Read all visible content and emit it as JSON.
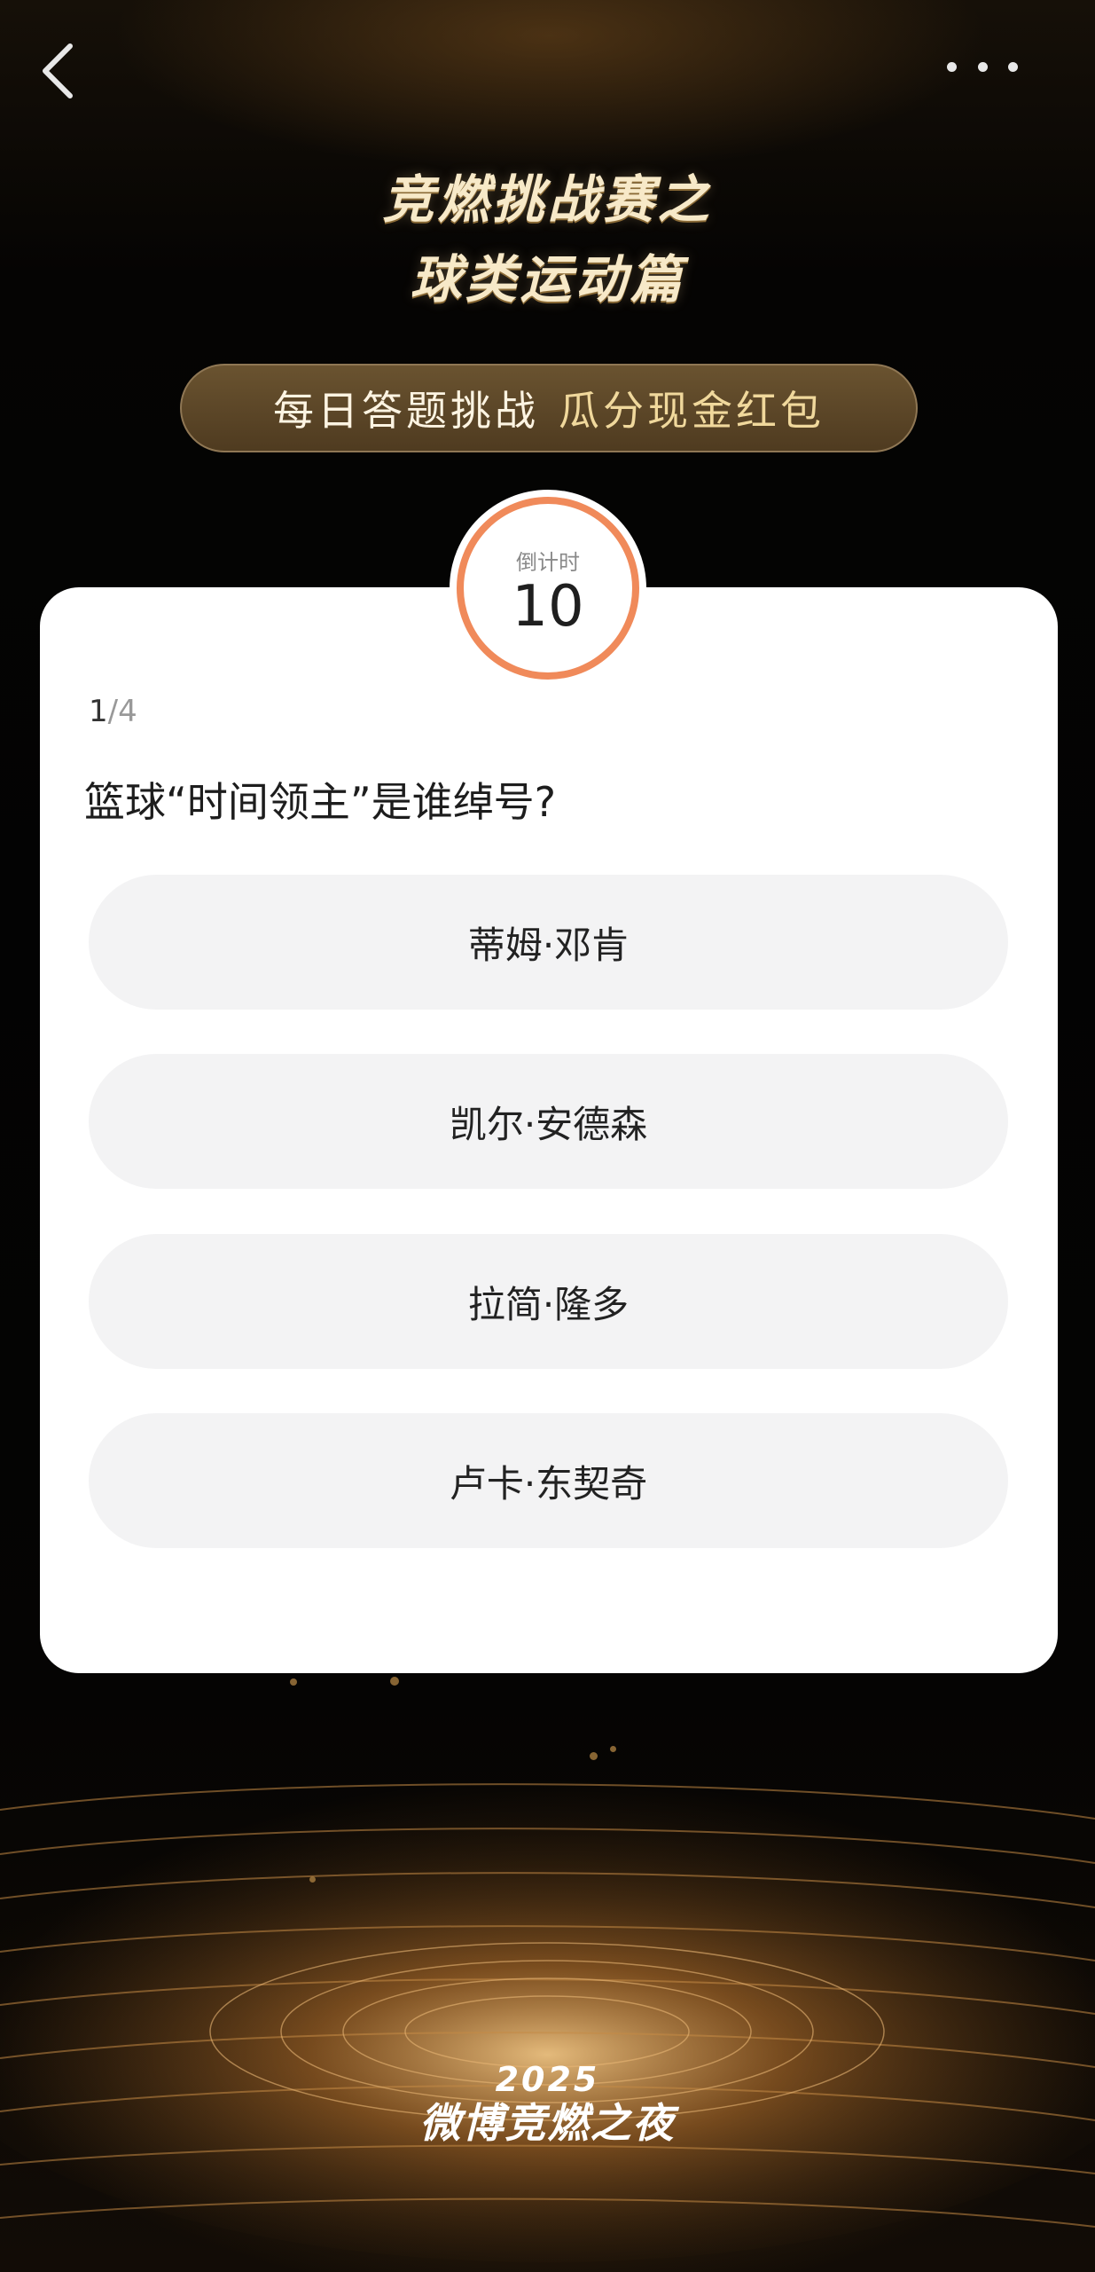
{
  "header": {
    "title_line1": "竞燃挑战赛之",
    "title_line2": "球类运动篇",
    "banner_part1": "每日答题挑战",
    "banner_part2": "瓜分现金红包"
  },
  "timer": {
    "label": "倒计时",
    "value": "10"
  },
  "quiz": {
    "progress_current": "1",
    "progress_total": "/4",
    "question": "篮球“时间领主”是谁绰号?",
    "options": [
      "蒂姆·邓肯",
      "凯尔·安德森",
      "拉简·隆多",
      "卢卡·东契奇"
    ]
  },
  "footer": {
    "logo_year": "2025",
    "logo_name": "微博竞燃之夜"
  },
  "icons": {
    "back": "chevron-left-icon",
    "more": "more-dots-icon"
  },
  "colors": {
    "timer_ring": "#f08a5a",
    "banner_bg": "#5a452a",
    "title_gold": "#f7e9c8",
    "option_bg": "#f3f3f4"
  }
}
